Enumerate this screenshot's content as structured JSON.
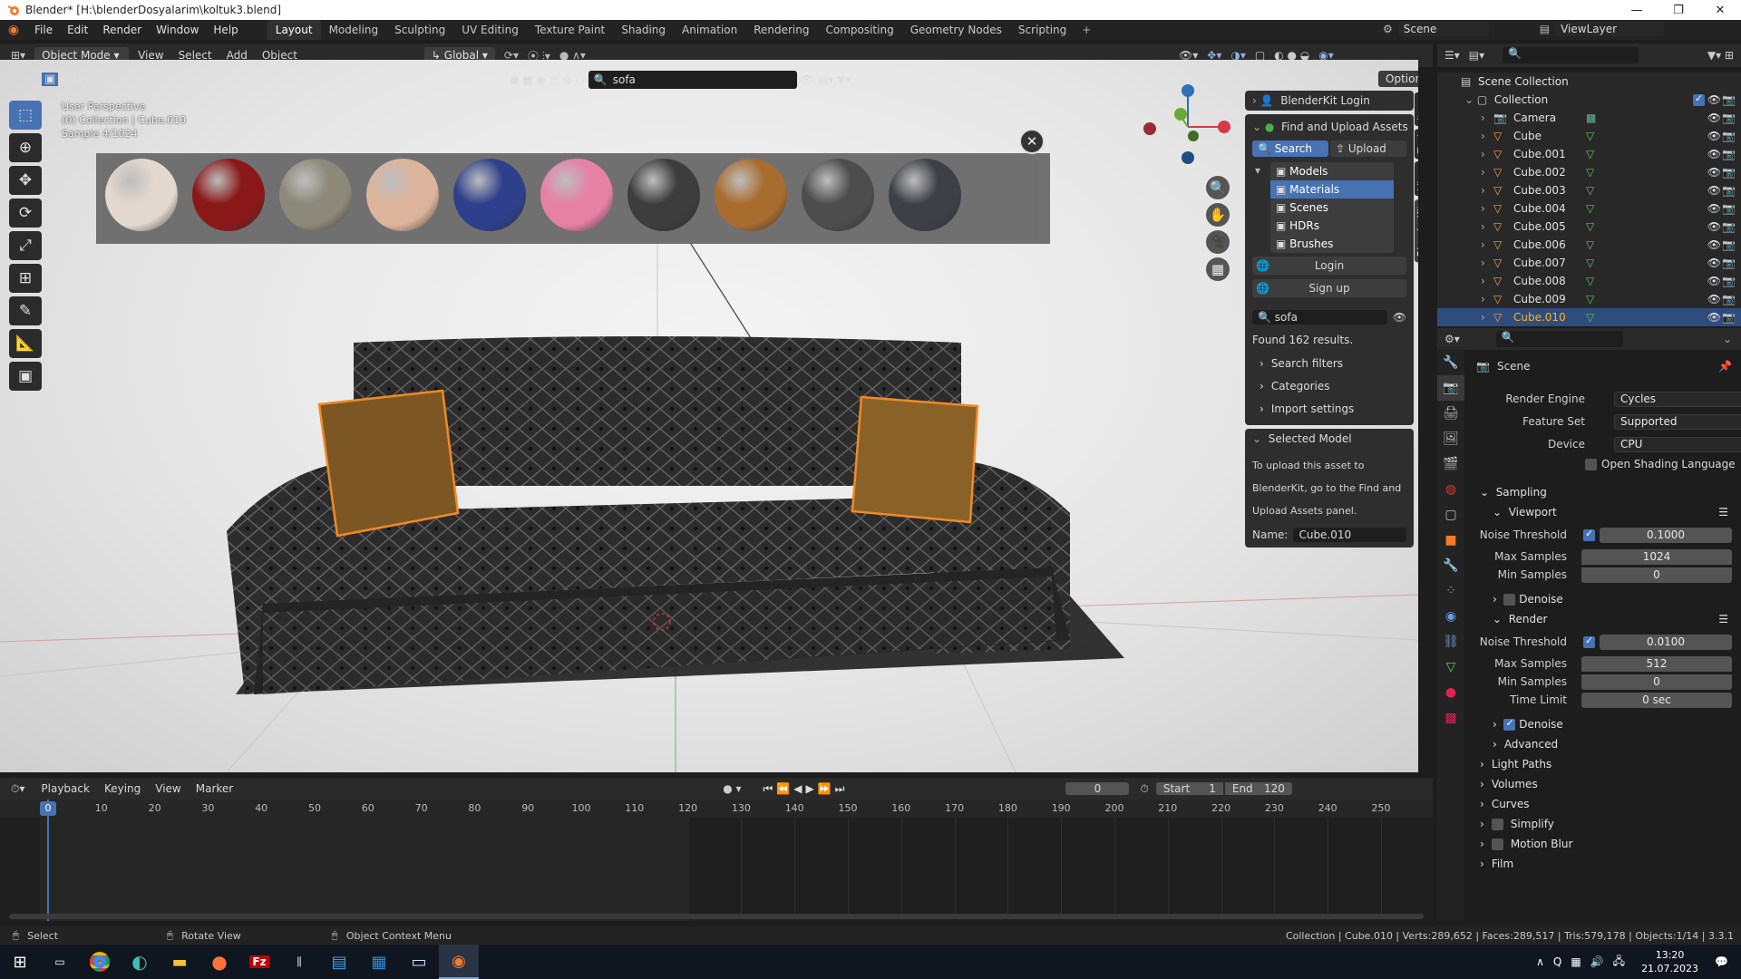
{
  "window": {
    "title": "Blender* [H:\\blenderDosyalarim\\koltuk3.blend]"
  },
  "menu": [
    "File",
    "Edit",
    "Render",
    "Window",
    "Help"
  ],
  "workspaces": [
    {
      "label": "Layout",
      "active": true
    },
    {
      "label": "Modeling"
    },
    {
      "label": "Sculpting"
    },
    {
      "label": "UV Editing"
    },
    {
      "label": "Texture Paint"
    },
    {
      "label": "Shading"
    },
    {
      "label": "Animation"
    },
    {
      "label": "Rendering"
    },
    {
      "label": "Compositing"
    },
    {
      "label": "Geometry Nodes"
    },
    {
      "label": "Scripting"
    }
  ],
  "scene_name": "Scene",
  "view_layer": "ViewLayer",
  "header": {
    "mode": "Object Mode",
    "menus": [
      "View",
      "Select",
      "Add",
      "Object"
    ],
    "orientation": "Global",
    "search": "sofa",
    "options": "Options"
  },
  "viewport": {
    "overlay": [
      "User Perspective",
      "(0) Collection | Cube.010",
      "Sample 4/1024"
    ],
    "side_tabs": [
      "Item",
      "Tool",
      "View",
      "BlenderKit"
    ]
  },
  "materials": [
    "#e3d8cf",
    "#8a1414",
    "#8b8778",
    "#dcb39a",
    "#2b3d8a",
    "#e67fa3",
    "#3a3a3a",
    "#a86a2c",
    "#4a4a4a",
    "#3b3d45"
  ],
  "blenderkit": {
    "login_title": "BlenderKit Login",
    "find_title": "Find and Upload Assets",
    "search_btn": "Search",
    "upload_btn": "Upload",
    "categories": [
      "Models",
      "Materials",
      "Scenes",
      "HDRs",
      "Brushes"
    ],
    "active_category": "Materials",
    "login": "Login",
    "signup": "Sign up",
    "query": "sofa",
    "results": "Found 162 results.",
    "sections": [
      "Search filters",
      "Categories",
      "Import settings"
    ],
    "selected_title": "Selected Model",
    "selected_text": [
      "To upload this asset to",
      "BlenderKit, go to the Find and",
      "Upload Assets panel."
    ],
    "name_label": "Name:",
    "name_value": "Cube.010"
  },
  "outliner": {
    "root": "Scene Collection",
    "collection": "Collection",
    "items": [
      "Camera",
      "Cube",
      "Cube.001",
      "Cube.002",
      "Cube.003",
      "Cube.004",
      "Cube.005",
      "Cube.006",
      "Cube.007",
      "Cube.008",
      "Cube.009",
      "Cube.010"
    ],
    "selected": "Cube.010"
  },
  "properties": {
    "scene": "Scene",
    "render_engine": {
      "label": "Render Engine",
      "value": "Cycles"
    },
    "feature_set": {
      "label": "Feature Set",
      "value": "Supported"
    },
    "device": {
      "label": "Device",
      "value": "CPU"
    },
    "osl": "Open Shading Language",
    "sampling": "Sampling",
    "viewport": {
      "title": "Viewport",
      "noise_label": "Noise Threshold",
      "noise": "0.1000",
      "max_label": "Max Samples",
      "max": "1024",
      "min_label": "Min Samples",
      "min": "0",
      "denoise": "Denoise"
    },
    "render": {
      "title": "Render",
      "noise_label": "Noise Threshold",
      "noise": "0.0100",
      "max_label": "Max Samples",
      "max": "512",
      "min_label": "Min Samples",
      "min": "0",
      "time_label": "Time Limit",
      "time": "0 sec",
      "denoise": "Denoise"
    },
    "sections": [
      "Advanced",
      "Light Paths",
      "Volumes",
      "Curves",
      "Simplify",
      "Motion Blur",
      "Film"
    ]
  },
  "timeline": {
    "menus": [
      "Playback",
      "Keying",
      "View",
      "Marker"
    ],
    "current": "0",
    "start_label": "Start",
    "start": "1",
    "end_label": "End",
    "end": "120",
    "ticks": [
      "0",
      "10",
      "20",
      "30",
      "40",
      "50",
      "60",
      "70",
      "80",
      "90",
      "100",
      "110",
      "120",
      "130",
      "140",
      "150",
      "160",
      "170",
      "180",
      "190",
      "200",
      "210",
      "220",
      "230",
      "240",
      "250"
    ]
  },
  "status": {
    "select": "Select",
    "rotate": "Rotate View",
    "context": "Object Context Menu",
    "stats": "Collection | Cube.010 | Verts:289,652 | Faces:289,517 | Tris:579,178 | Objects:1/14 | 3.3.1"
  },
  "clock": {
    "time": "13:20",
    "date": "21.07.2023"
  }
}
